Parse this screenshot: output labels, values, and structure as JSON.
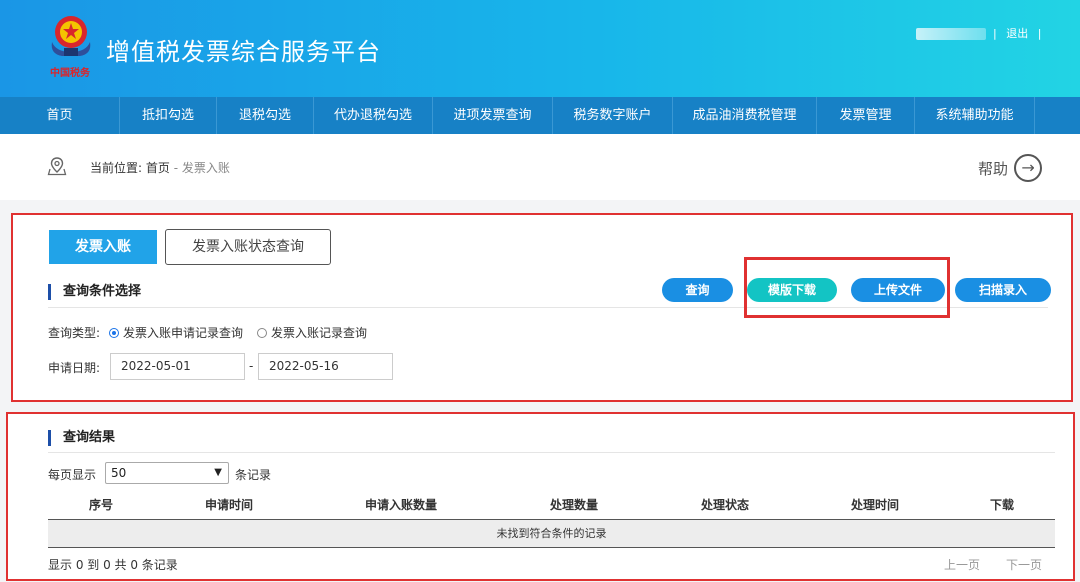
{
  "header": {
    "logo_sub": "中国税务",
    "title": "增值税发票综合服务平台",
    "logout": "退出"
  },
  "nav": [
    {
      "label": "首页"
    },
    {
      "label": "抵扣勾选"
    },
    {
      "label": "退税勾选"
    },
    {
      "label": "代办退税勾选"
    },
    {
      "label": "进项发票查询"
    },
    {
      "label": "税务数字账户"
    },
    {
      "label": "成品油消费税管理"
    },
    {
      "label": "发票管理"
    },
    {
      "label": "系统辅助功能"
    }
  ],
  "breadcrumb": {
    "prefix": "当前位置:",
    "home": "首页",
    "sep": " - ",
    "current": "发票入账",
    "help": "帮助"
  },
  "tabs": {
    "active": "发票入账",
    "other": "发票入账状态查询"
  },
  "query": {
    "section_title": "查询条件选择",
    "btn_query": "查询",
    "btn_template": "模版下载",
    "btn_upload": "上传文件",
    "btn_scan": "扫描录入",
    "type_label": "查询类型:",
    "type_option1": "发票入账申请记录查询",
    "type_option2": "发票入账记录查询",
    "date_label": "申请日期:",
    "date_from": "2022-05-01",
    "date_sep": "-",
    "date_to": "2022-05-16"
  },
  "results": {
    "section_title": "查询结果",
    "per_page_prefix": "每页显示",
    "per_page_value": "50",
    "per_page_suffix": "条记录",
    "columns": [
      "序号",
      "申请时间",
      "申请入账数量",
      "处理数量",
      "处理状态",
      "处理时间",
      "下载"
    ],
    "empty": "未找到符合条件的记录",
    "summary": "显示 0 到 0 共 0 条记录",
    "prev": "上一页",
    "next": "下一页"
  },
  "colors": {
    "header_start": "#1a96e6",
    "header_end": "#22d4e4",
    "nav_bg": "#1781c6",
    "accent_blue": "#1a8fe3",
    "accent_teal": "#13c4c4",
    "highlight_red": "#e03131"
  },
  "icons": {
    "emblem": "national-tax-emblem-icon",
    "location": "map-pin-icon",
    "help": "arrow-right-circle-icon",
    "select": "chevron-down-icon"
  }
}
